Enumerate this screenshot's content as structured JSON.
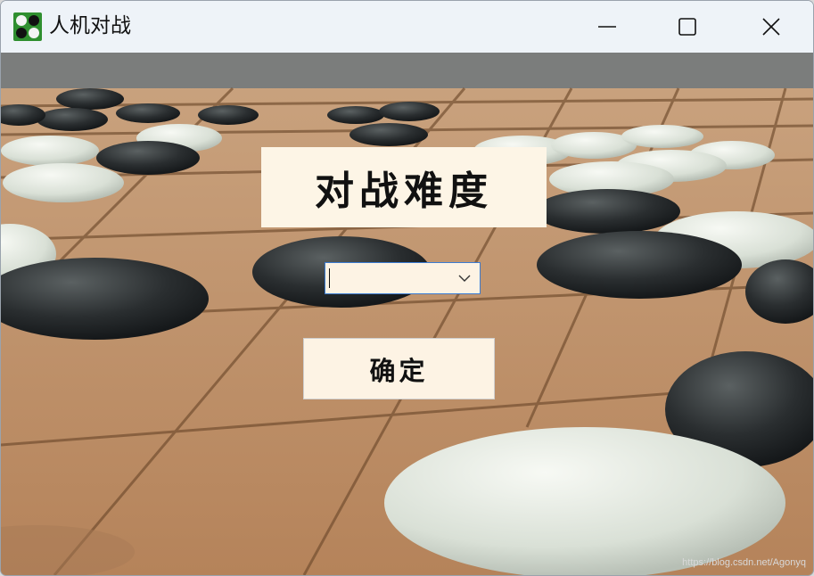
{
  "window": {
    "title": "人机对战",
    "app_icon": "go-stones-icon",
    "controls": [
      "minimize-icon",
      "maximize-icon",
      "close-icon"
    ]
  },
  "main": {
    "heading": "对战难度",
    "difficulty_select": {
      "value": ""
    },
    "confirm_label": "确定"
  },
  "watermark": "https://blog.csdn.net/Agonyq",
  "colors": {
    "titlebar": "#eef3f8",
    "panel": "#fdf5e6",
    "select_border": "#3b7bd1",
    "board_wood": "#c49a74"
  }
}
